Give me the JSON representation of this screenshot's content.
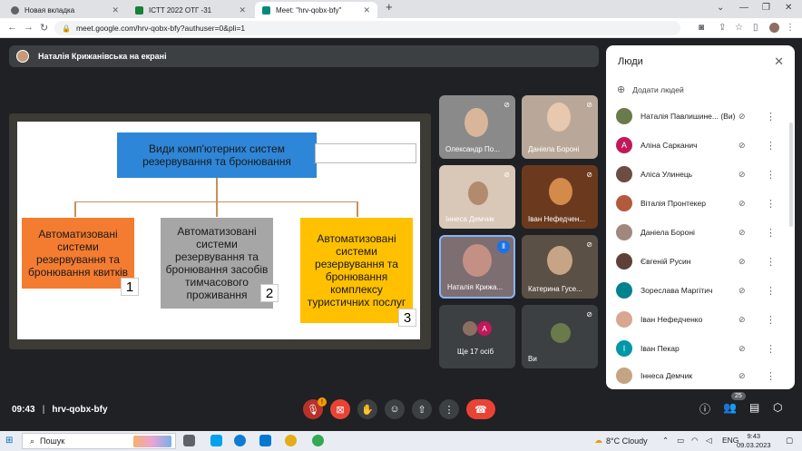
{
  "tabs": [
    {
      "title": "Новая вкладка",
      "icon": "chrome-icon"
    },
    {
      "title": "ICTT 2022 ОТГ -31",
      "icon": "classroom-icon"
    },
    {
      "title": "Meet: \"hrv-qobx-bfy\"",
      "icon": "meet-icon"
    }
  ],
  "address": {
    "url": "meet.google.com/hrv-qobx-bfy?authuser=0&pli=1"
  },
  "presenter": {
    "label": "Наталія Крижанівська на екрані"
  },
  "slide": {
    "title": "Види комп'ютерних систем резервування та бронювання",
    "boxes": [
      {
        "text": "Автоматизовані системи резервування та бронювання квитків",
        "num": "1",
        "color": "#f47c30"
      },
      {
        "text": "Автоматизовані системи резервування та бронювання засобів тимчасового проживання",
        "num": "2",
        "color": "#a6a6a6"
      },
      {
        "text": "Автоматизовані системи резервування та бронювання комплексу туристичних послуг",
        "num": "3",
        "color": "#ffc000"
      }
    ]
  },
  "tiles": [
    {
      "name": "Олександр По...",
      "bg": "#8a8a8a"
    },
    {
      "name": "Даніела Бороні",
      "bg": "#b9a89a"
    },
    {
      "name": "Іннеса Демчик",
      "bg": "#d9c7b8"
    },
    {
      "name": "Іван Нефедчен...",
      "bg": "#6b3a1e"
    },
    {
      "name": "Наталія Крижа...",
      "bg": "#7d6e72"
    },
    {
      "name": "Катерина Гусе...",
      "bg": "#5a5045"
    },
    {
      "name": "Ще 17 осіб",
      "bg": "#3c4043"
    },
    {
      "name": "Ви",
      "bg": "#3c4043"
    }
  ],
  "people": {
    "title": "Люди",
    "add_label": "Додати людей",
    "list": [
      {
        "name": "Наталія Павлишине... (Ви)",
        "avatar": "#6b7a4a",
        "letter": ""
      },
      {
        "name": "Аліна Сарканич",
        "avatar": "#c2185b",
        "letter": "А"
      },
      {
        "name": "Аліса Улинець",
        "avatar": "#6d4c41",
        "letter": ""
      },
      {
        "name": "Віталія Пронтекер",
        "avatar": "#b45a3c",
        "letter": ""
      },
      {
        "name": "Даніела Бороні",
        "avatar": "#a1887f",
        "letter": ""
      },
      {
        "name": "Євгеній Русин",
        "avatar": "#5d4037",
        "letter": ""
      },
      {
        "name": "Зореслава Маргітич",
        "avatar": "#00838f",
        "letter": ""
      },
      {
        "name": "Іван Нефедченко",
        "avatar": "#d7a790",
        "letter": ""
      },
      {
        "name": "Іван Пекар",
        "avatar": "#0097a7",
        "letter": "І"
      },
      {
        "name": "Іннеса Демчик",
        "avatar": "#c4a484",
        "letter": ""
      }
    ]
  },
  "bottom": {
    "time": "09:43",
    "room": "hrv-qobx-bfy",
    "participants_count": "25",
    "notif_count": "!"
  },
  "taskbar": {
    "search_placeholder": "Пошук",
    "weather": "8°C  Cloudy",
    "lang": "ENG",
    "time": "9:43",
    "date": "09.03.2023"
  }
}
